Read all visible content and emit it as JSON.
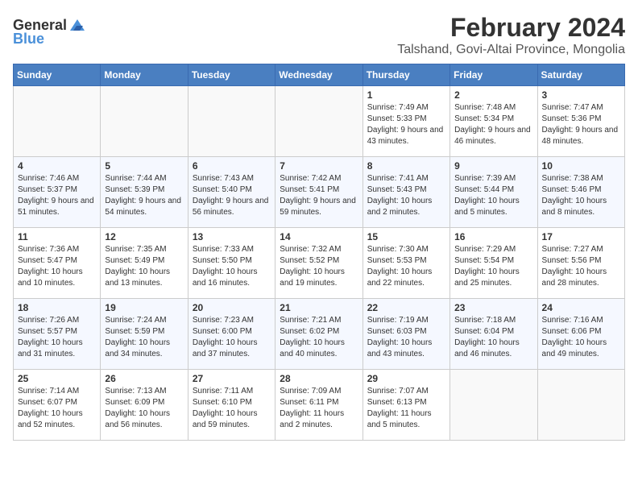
{
  "header": {
    "logo_general": "General",
    "logo_blue": "Blue",
    "month_year": "February 2024",
    "location": "Talshand, Govi-Altai Province, Mongolia"
  },
  "days_of_week": [
    "Sunday",
    "Monday",
    "Tuesday",
    "Wednesday",
    "Thursday",
    "Friday",
    "Saturday"
  ],
  "weeks": [
    [
      {
        "day": "",
        "sunrise": "",
        "sunset": "",
        "daylight": "",
        "empty": true
      },
      {
        "day": "",
        "sunrise": "",
        "sunset": "",
        "daylight": "",
        "empty": true
      },
      {
        "day": "",
        "sunrise": "",
        "sunset": "",
        "daylight": "",
        "empty": true
      },
      {
        "day": "",
        "sunrise": "",
        "sunset": "",
        "daylight": "",
        "empty": true
      },
      {
        "day": "1",
        "sunrise": "Sunrise: 7:49 AM",
        "sunset": "Sunset: 5:33 PM",
        "daylight": "Daylight: 9 hours and 43 minutes."
      },
      {
        "day": "2",
        "sunrise": "Sunrise: 7:48 AM",
        "sunset": "Sunset: 5:34 PM",
        "daylight": "Daylight: 9 hours and 46 minutes."
      },
      {
        "day": "3",
        "sunrise": "Sunrise: 7:47 AM",
        "sunset": "Sunset: 5:36 PM",
        "daylight": "Daylight: 9 hours and 48 minutes."
      }
    ],
    [
      {
        "day": "4",
        "sunrise": "Sunrise: 7:46 AM",
        "sunset": "Sunset: 5:37 PM",
        "daylight": "Daylight: 9 hours and 51 minutes."
      },
      {
        "day": "5",
        "sunrise": "Sunrise: 7:44 AM",
        "sunset": "Sunset: 5:39 PM",
        "daylight": "Daylight: 9 hours and 54 minutes."
      },
      {
        "day": "6",
        "sunrise": "Sunrise: 7:43 AM",
        "sunset": "Sunset: 5:40 PM",
        "daylight": "Daylight: 9 hours and 56 minutes."
      },
      {
        "day": "7",
        "sunrise": "Sunrise: 7:42 AM",
        "sunset": "Sunset: 5:41 PM",
        "daylight": "Daylight: 9 hours and 59 minutes."
      },
      {
        "day": "8",
        "sunrise": "Sunrise: 7:41 AM",
        "sunset": "Sunset: 5:43 PM",
        "daylight": "Daylight: 10 hours and 2 minutes."
      },
      {
        "day": "9",
        "sunrise": "Sunrise: 7:39 AM",
        "sunset": "Sunset: 5:44 PM",
        "daylight": "Daylight: 10 hours and 5 minutes."
      },
      {
        "day": "10",
        "sunrise": "Sunrise: 7:38 AM",
        "sunset": "Sunset: 5:46 PM",
        "daylight": "Daylight: 10 hours and 8 minutes."
      }
    ],
    [
      {
        "day": "11",
        "sunrise": "Sunrise: 7:36 AM",
        "sunset": "Sunset: 5:47 PM",
        "daylight": "Daylight: 10 hours and 10 minutes."
      },
      {
        "day": "12",
        "sunrise": "Sunrise: 7:35 AM",
        "sunset": "Sunset: 5:49 PM",
        "daylight": "Daylight: 10 hours and 13 minutes."
      },
      {
        "day": "13",
        "sunrise": "Sunrise: 7:33 AM",
        "sunset": "Sunset: 5:50 PM",
        "daylight": "Daylight: 10 hours and 16 minutes."
      },
      {
        "day": "14",
        "sunrise": "Sunrise: 7:32 AM",
        "sunset": "Sunset: 5:52 PM",
        "daylight": "Daylight: 10 hours and 19 minutes."
      },
      {
        "day": "15",
        "sunrise": "Sunrise: 7:30 AM",
        "sunset": "Sunset: 5:53 PM",
        "daylight": "Daylight: 10 hours and 22 minutes."
      },
      {
        "day": "16",
        "sunrise": "Sunrise: 7:29 AM",
        "sunset": "Sunset: 5:54 PM",
        "daylight": "Daylight: 10 hours and 25 minutes."
      },
      {
        "day": "17",
        "sunrise": "Sunrise: 7:27 AM",
        "sunset": "Sunset: 5:56 PM",
        "daylight": "Daylight: 10 hours and 28 minutes."
      }
    ],
    [
      {
        "day": "18",
        "sunrise": "Sunrise: 7:26 AM",
        "sunset": "Sunset: 5:57 PM",
        "daylight": "Daylight: 10 hours and 31 minutes."
      },
      {
        "day": "19",
        "sunrise": "Sunrise: 7:24 AM",
        "sunset": "Sunset: 5:59 PM",
        "daylight": "Daylight: 10 hours and 34 minutes."
      },
      {
        "day": "20",
        "sunrise": "Sunrise: 7:23 AM",
        "sunset": "Sunset: 6:00 PM",
        "daylight": "Daylight: 10 hours and 37 minutes."
      },
      {
        "day": "21",
        "sunrise": "Sunrise: 7:21 AM",
        "sunset": "Sunset: 6:02 PM",
        "daylight": "Daylight: 10 hours and 40 minutes."
      },
      {
        "day": "22",
        "sunrise": "Sunrise: 7:19 AM",
        "sunset": "Sunset: 6:03 PM",
        "daylight": "Daylight: 10 hours and 43 minutes."
      },
      {
        "day": "23",
        "sunrise": "Sunrise: 7:18 AM",
        "sunset": "Sunset: 6:04 PM",
        "daylight": "Daylight: 10 hours and 46 minutes."
      },
      {
        "day": "24",
        "sunrise": "Sunrise: 7:16 AM",
        "sunset": "Sunset: 6:06 PM",
        "daylight": "Daylight: 10 hours and 49 minutes."
      }
    ],
    [
      {
        "day": "25",
        "sunrise": "Sunrise: 7:14 AM",
        "sunset": "Sunset: 6:07 PM",
        "daylight": "Daylight: 10 hours and 52 minutes."
      },
      {
        "day": "26",
        "sunrise": "Sunrise: 7:13 AM",
        "sunset": "Sunset: 6:09 PM",
        "daylight": "Daylight: 10 hours and 56 minutes."
      },
      {
        "day": "27",
        "sunrise": "Sunrise: 7:11 AM",
        "sunset": "Sunset: 6:10 PM",
        "daylight": "Daylight: 10 hours and 59 minutes."
      },
      {
        "day": "28",
        "sunrise": "Sunrise: 7:09 AM",
        "sunset": "Sunset: 6:11 PM",
        "daylight": "Daylight: 11 hours and 2 minutes."
      },
      {
        "day": "29",
        "sunrise": "Sunrise: 7:07 AM",
        "sunset": "Sunset: 6:13 PM",
        "daylight": "Daylight: 11 hours and 5 minutes."
      },
      {
        "day": "",
        "sunrise": "",
        "sunset": "",
        "daylight": "",
        "empty": true
      },
      {
        "day": "",
        "sunrise": "",
        "sunset": "",
        "daylight": "",
        "empty": true
      }
    ]
  ]
}
